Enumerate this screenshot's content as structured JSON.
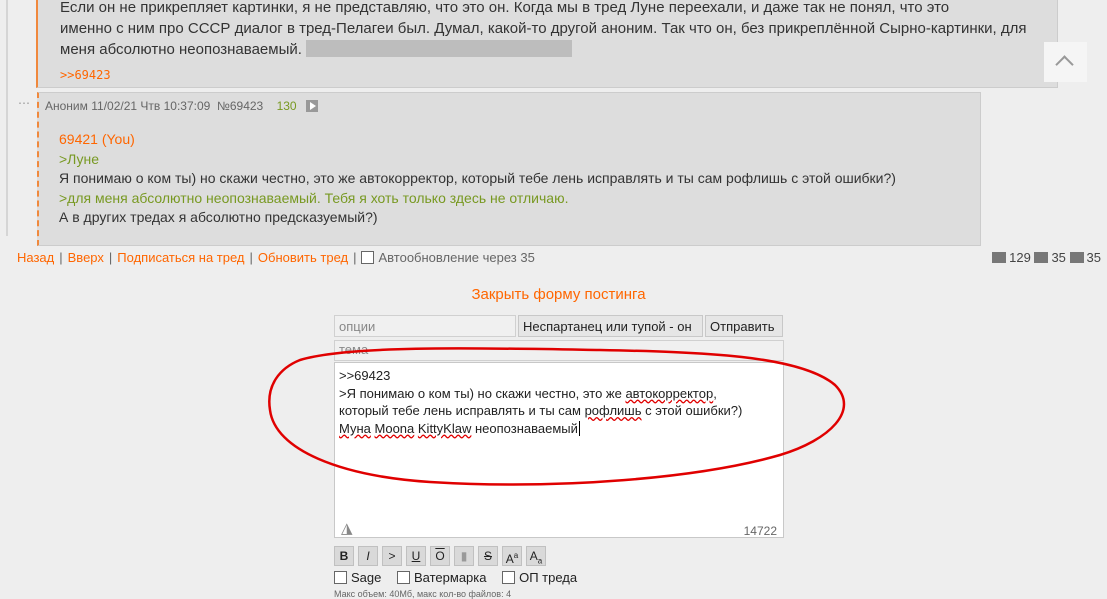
{
  "post1": {
    "lines": [
      "Если он не прикрепляет картинки, я не представляю, что это он. Когда мы в тред Луне переехали, и даже так не понял, что это",
      "именно с ним про СССР диалог в тред-Пелагеи был. Думал, какой-то другой аноним. Так что он, без прикреплённой Сырно-картинки, для",
      "меня абсолютно неопознаваемый."
    ],
    "reply_ref": ">>69423"
  },
  "post2": {
    "author": "Аноним",
    "datetime": "11/02/21 Чтв 10:37:09",
    "number": "№69423",
    "count": "130",
    "reply_link": "69421 (You)",
    "quote1": ">Луне",
    "line1": "Я понимаю о ком ты) но скажи честно, это же автокорректор, который тебе лень исправлять и ты сам рофлишь с этой ошибки?)",
    "quote2": ">для меня абсолютно неопознаваемый. Тебя я хоть только здесь не отличаю.",
    "line2": "А в других тредах я абсолютно предсказуемый?)"
  },
  "nav": {
    "back": "Назад",
    "up": "Вверх",
    "subscribe": "Подписаться на тред",
    "refresh": "Обновить тред",
    "autoupdate": "Автообновление через 35"
  },
  "stats": {
    "posts": "129",
    "images": "35",
    "users": "35"
  },
  "form": {
    "close_label": "Закрыть форму постинга",
    "options_placeholder": "опции",
    "name_value": "Неспартанец или тупой - он",
    "submit_label": "Отправить",
    "subject_placeholder": "тема",
    "text_line1": ">>69423",
    "text_line2": ">Я понимаю о ком ты) но скажи честно, это же ",
    "text_spell1": "автокорректор",
    "text_line2_end": ",",
    "text_line3a": "который тебе лень исправлять и ты сам ",
    "text_spell2": "рофлишь",
    "text_line3b": " с этой ошибки?)",
    "text_w1": "Муна",
    "text_w2": "Moona",
    "text_w3": "KittyKlaw",
    "text_w4": "неопознаваемый",
    "char_count": "14722",
    "format_buttons": [
      "B",
      "I",
      ">",
      "U",
      "O",
      "▮",
      "S",
      "A",
      "A"
    ],
    "format_sup": [
      "",
      "",
      "",
      "",
      "",
      "",
      "",
      "a",
      "a"
    ],
    "options": [
      "Sage",
      "Ватермарка",
      "ОП треда"
    ],
    "limits": "Макс объем: 40Мб, макс кол-во файлов: 4"
  },
  "colors": {
    "accent": "#FF6600",
    "quote": "#789922",
    "annotation": "#E00000"
  }
}
